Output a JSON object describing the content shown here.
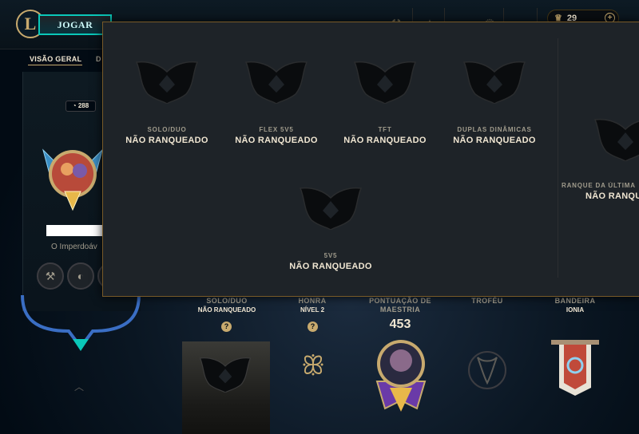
{
  "topbar": {
    "logo_letter": "L",
    "play_label": "JOGAR",
    "currency_amount": "29",
    "currency_add": "+"
  },
  "tabs": [
    {
      "label": "VISÃO GERAL"
    },
    {
      "label": "D"
    }
  ],
  "profile": {
    "level": "288",
    "title": "O Imperdoáv"
  },
  "stats": [
    {
      "label": "SOLO/DUO",
      "sub": "NÃO RANQUEADO"
    },
    {
      "label": "HONRA",
      "sub": "NÍVEL 2"
    },
    {
      "label": "PONTUAÇÃO DE",
      "label2": "MAESTRIA",
      "value": "453"
    },
    {
      "label": "TROFÉU"
    },
    {
      "label": "BANDEIRA",
      "sub": "IONIA"
    }
  ],
  "help_mark": "?",
  "ranked_popup": {
    "entries": [
      {
        "queue": "SOLO/DUO",
        "status": "NÃO RANQUEADO"
      },
      {
        "queue": "FLEX 5V5",
        "status": "NÃO RANQUEADO"
      },
      {
        "queue": "TFT",
        "status": "NÃO RANQUEADO"
      },
      {
        "queue": "DUPLAS DINÂMICAS",
        "status": "NÃO RANQUEADO"
      },
      {
        "queue": "5V5",
        "status": "NÃO RANQUEADO"
      }
    ],
    "last_season": {
      "queue": "RANQUE DA ÚLTIMA",
      "status": "NÃO RANQU"
    }
  },
  "colors": {
    "gold": "#c8aa6e",
    "cyan": "#0ac8b9",
    "text": "#f0e6d2",
    "muted": "#a09b8c",
    "popup_bg": "#1e2328"
  },
  "icons": [
    "league-logo-icon",
    "rank-emblem-icon",
    "honor-icon",
    "mastery-crest-icon",
    "trophy-icon",
    "banner-icon",
    "chevron-up-icon",
    "question-icon"
  ]
}
